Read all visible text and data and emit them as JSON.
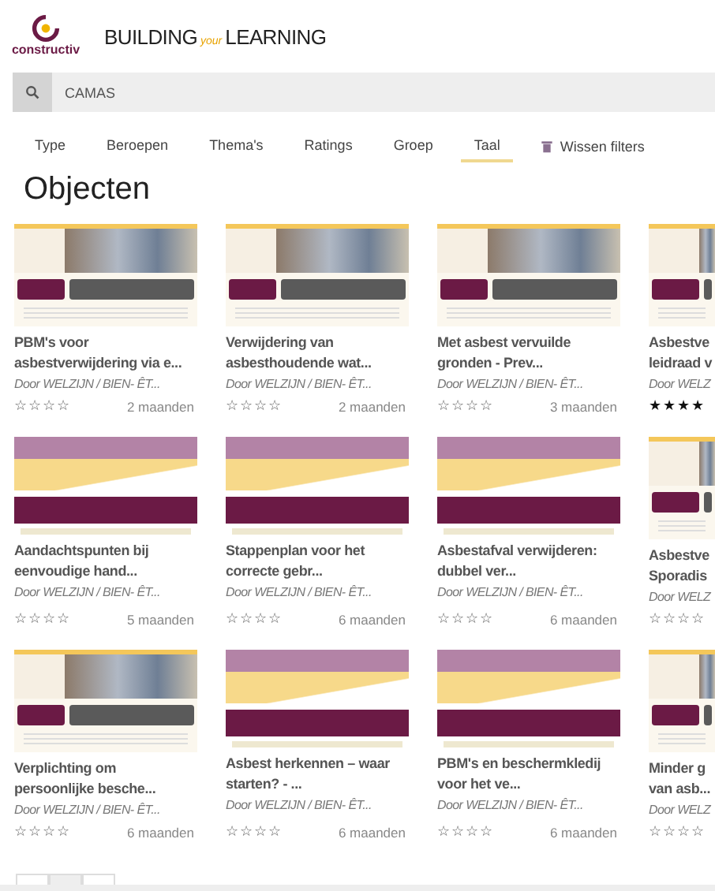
{
  "brand": {
    "wordmark": "constructiv",
    "tagline": [
      "BUILDING",
      "your",
      "LEARNING"
    ]
  },
  "search": {
    "value": "CAMAS"
  },
  "filters": [
    {
      "label": "Type",
      "selected": false
    },
    {
      "label": "Beroepen",
      "selected": false
    },
    {
      "label": "Thema's",
      "selected": false
    },
    {
      "label": "Ratings",
      "selected": false
    },
    {
      "label": "Groep",
      "selected": false
    },
    {
      "label": "Taal",
      "selected": true
    }
  ],
  "clear_filters": "Wissen filters",
  "heading": "Objecten",
  "cards": [
    {
      "kind": "photo",
      "title": "PBM's voor asbestverwijdering via e...",
      "author": "Door WELZIJN / BIEN- ÊT...",
      "stars": 0,
      "age": "2 maanden"
    },
    {
      "kind": "photo",
      "title": "Verwijdering van asbesthoudende wat...",
      "author": "Door WELZIJN / BIEN- ÊT...",
      "stars": 0,
      "age": "2 maanden"
    },
    {
      "kind": "photo",
      "title": "Met asbest vervuilde gronden - Prev...",
      "author": "Door WELZIJN / BIEN- ÊT...",
      "stars": 0,
      "age": "3 maanden"
    },
    {
      "kind": "photo",
      "title": "Asbestve leidraad v",
      "author": "Door WELZ",
      "stars": 4
    },
    {
      "kind": "banner",
      "title": "Aandachtspunten bij eenvoudige hand...",
      "author": "Door WELZIJN / BIEN- ÊT...",
      "stars": 0,
      "age": "5 maanden"
    },
    {
      "kind": "banner",
      "title": "Stappenplan voor het correcte gebr...",
      "author": "Door WELZIJN / BIEN- ÊT...",
      "stars": 0,
      "age": "6 maanden"
    },
    {
      "kind": "banner",
      "title": "Asbestafval verwijderen: dubbel ver...",
      "author": "Door WELZIJN / BIEN- ÊT...",
      "stars": 0,
      "age": "6 maanden"
    },
    {
      "kind": "photo",
      "title": "Asbestve Sporadis",
      "author": "Door WELZ",
      "stars": 0
    },
    {
      "kind": "photo",
      "title": "Verplichting om persoonlijke besche...",
      "author": "Door WELZIJN / BIEN- ÊT...",
      "stars": 0,
      "age": "6 maanden"
    },
    {
      "kind": "banner",
      "title": "Asbest herkennen – waar starten? - ...",
      "author": "Door WELZIJN / BIEN- ÊT...",
      "stars": 0,
      "age": "6 maanden"
    },
    {
      "kind": "banner",
      "title": "PBM's en beschermkledij voor het ve...",
      "author": "Door WELZIJN / BIEN- ÊT...",
      "stars": 0,
      "age": "6 maanden"
    },
    {
      "kind": "photo",
      "title": "Minder g van asb...",
      "author": "Door WELZ",
      "stars": 0
    }
  ]
}
